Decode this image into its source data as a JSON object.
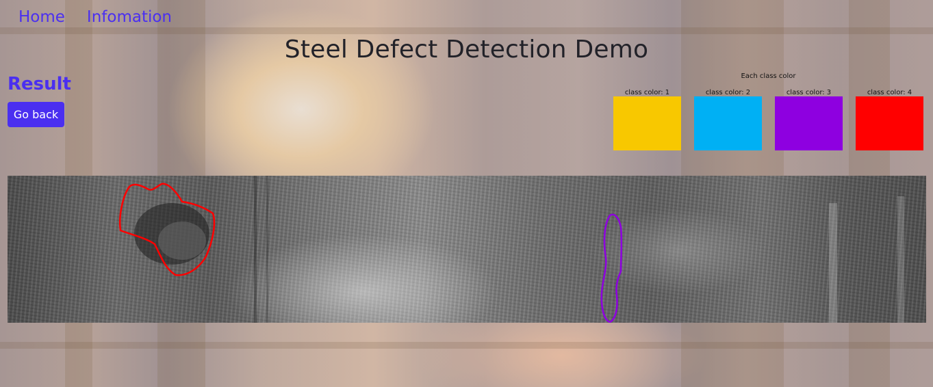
{
  "nav": {
    "home_label": "Home",
    "info_label": "Infomation"
  },
  "page": {
    "title": "Steel Defect Detection Demo"
  },
  "result": {
    "heading": "Result",
    "back_label": "Go back"
  },
  "legend": {
    "title": "Each class color",
    "items": [
      {
        "label": "class color: 1",
        "color": "#f8c800"
      },
      {
        "label": "class color: 2",
        "color": "#00b0f4"
      },
      {
        "label": "class color: 3",
        "color": "#8e00e0"
      },
      {
        "label": "class color: 4",
        "color": "#ff0000"
      }
    ]
  },
  "colors": {
    "accent": "#4a2ff0",
    "title_text": "#222229"
  },
  "detections": [
    {
      "class": 4,
      "color": "#ff0000"
    },
    {
      "class": 3,
      "color": "#8e00e0"
    }
  ]
}
